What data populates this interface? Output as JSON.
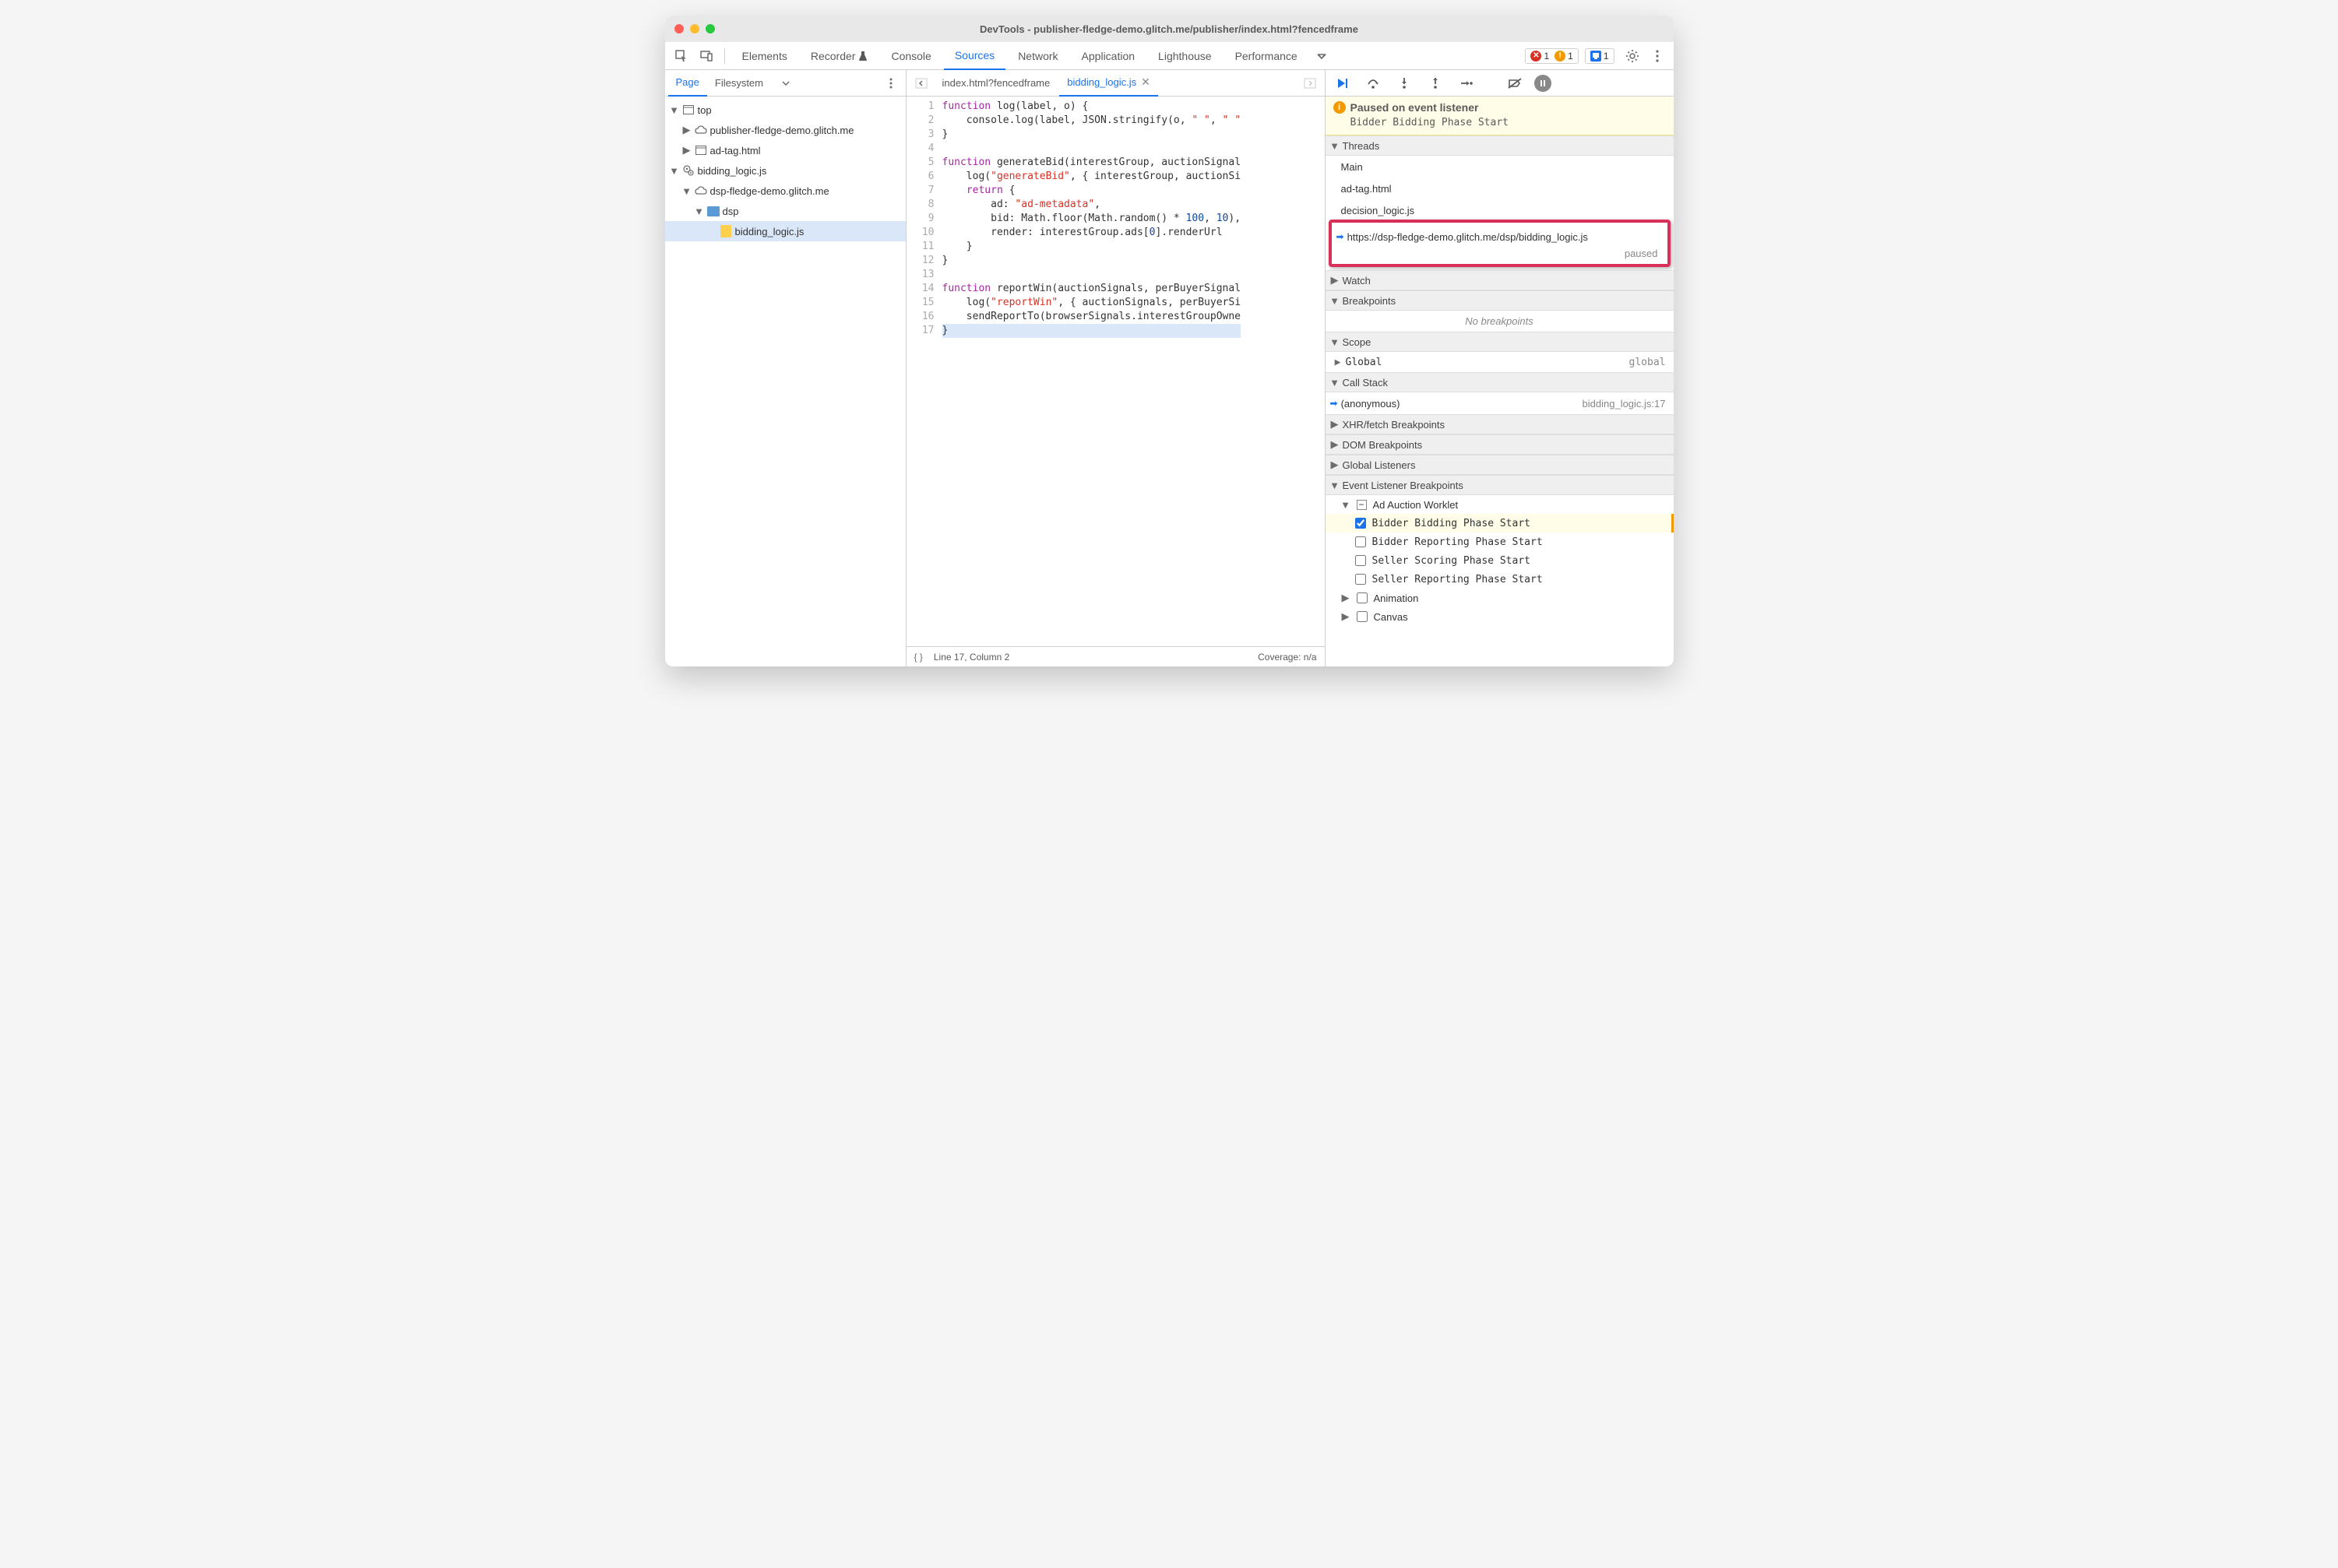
{
  "window": {
    "title": "DevTools - publisher-fledge-demo.glitch.me/publisher/index.html?fencedframe"
  },
  "toolbar": {
    "tabs": [
      "Elements",
      "Recorder",
      "Console",
      "Sources",
      "Network",
      "Application",
      "Lighthouse",
      "Performance"
    ],
    "active": "Sources",
    "errors": "1",
    "warnings": "1",
    "issues": "1"
  },
  "navigator": {
    "tabs": [
      "Page",
      "Filesystem"
    ],
    "active": "Page",
    "tree": {
      "top": "top",
      "n1": "publisher-fledge-demo.glitch.me",
      "n2": "ad-tag.html",
      "n3": "bidding_logic.js",
      "n4": "dsp-fledge-demo.glitch.me",
      "n5": "dsp",
      "n6": "bidding_logic.js"
    }
  },
  "editor": {
    "tabs": [
      {
        "name": "index.html?fencedframe",
        "active": false
      },
      {
        "name": "bidding_logic.js",
        "active": true
      }
    ],
    "lines": 17,
    "status_left": "Line 17, Column 2",
    "status_right": "Coverage: n/a",
    "code_tokens": {
      "l1": [
        "function",
        " log(label, o) {"
      ],
      "l2": [
        "    console.log(label, JSON.stringify(o, ",
        {
          "s": "\" \""
        },
        ", ",
        {
          "s": "\" \""
        }
      ],
      "l3": [
        "}"
      ],
      "l5": [
        "function",
        " generateBid(interestGroup, auctionSignal"
      ],
      "l6": [
        "    log(",
        {
          "s": "\"generateBid\""
        },
        ", { interestGroup, auctionSi"
      ],
      "l7": [
        "    ",
        "return",
        " {"
      ],
      "l8": [
        "        ad: ",
        {
          "s": "\"ad-metadata\""
        },
        ","
      ],
      "l9": [
        "        bid: Math.floor(Math.random() * ",
        {
          "n": "100"
        },
        ", ",
        {
          "n": "10"
        },
        "),"
      ],
      "l10": [
        "        render: interestGroup.ads[",
        {
          "n": "0"
        },
        "].renderUrl"
      ],
      "l11": [
        "    }"
      ],
      "l12": [
        "}"
      ],
      "l14": [
        "function",
        " reportWin(auctionSignals, perBuyerSignal"
      ],
      "l15": [
        "    log(",
        {
          "s": "\"reportWin\""
        },
        ", { auctionSignals, perBuyerSi"
      ],
      "l16": [
        "    sendReportTo(browserSignals.interestGroupOwne"
      ],
      "l17": [
        "}"
      ]
    }
  },
  "debugger": {
    "paused": {
      "title": "Paused on event listener",
      "msg": "Bidder Bidding Phase Start"
    },
    "sections": {
      "threads": "Threads",
      "watch": "Watch",
      "breakpoints": "Breakpoints",
      "scope": "Scope",
      "callstack": "Call Stack",
      "xhr": "XHR/fetch Breakpoints",
      "dom": "DOM Breakpoints",
      "global": "Global Listeners",
      "event": "Event Listener Breakpoints"
    },
    "threads": [
      "Main",
      "ad-tag.html",
      "decision_logic.js"
    ],
    "thread_hl": {
      "url": "https://dsp-fledge-demo.glitch.me/dsp/bidding_logic.js",
      "state": "paused"
    },
    "no_breakpoints": "No breakpoints",
    "scope": {
      "global_label": "Global",
      "global_val": "global"
    },
    "callstack": {
      "fn": "(anonymous)",
      "loc": "bidding_logic.js:17"
    },
    "event_cats": {
      "adauction": "Ad Auction Worklet",
      "items": [
        {
          "label": "Bidder Bidding Phase Start",
          "checked": true
        },
        {
          "label": "Bidder Reporting Phase Start",
          "checked": false
        },
        {
          "label": "Seller Scoring Phase Start",
          "checked": false
        },
        {
          "label": "Seller Reporting Phase Start",
          "checked": false
        }
      ],
      "animation": "Animation",
      "canvas": "Canvas"
    }
  }
}
